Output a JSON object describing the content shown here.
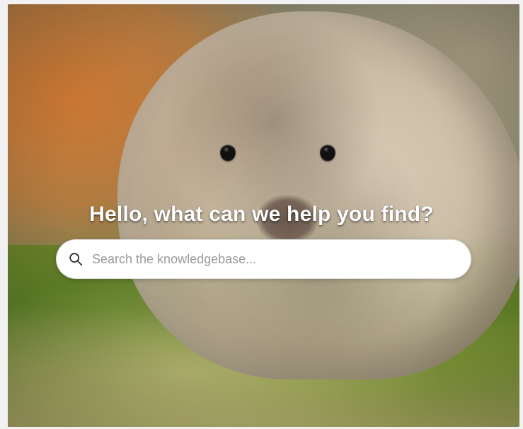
{
  "hero": {
    "headline": "Hello, what can we help you find?"
  },
  "search": {
    "placeholder": "Search the knowledgebase...",
    "value": ""
  },
  "icons": {
    "search": "search-icon"
  },
  "colors": {
    "headline_text": "#ffffff",
    "search_bg": "#ffffff",
    "search_placeholder": "#9a9a9a"
  }
}
